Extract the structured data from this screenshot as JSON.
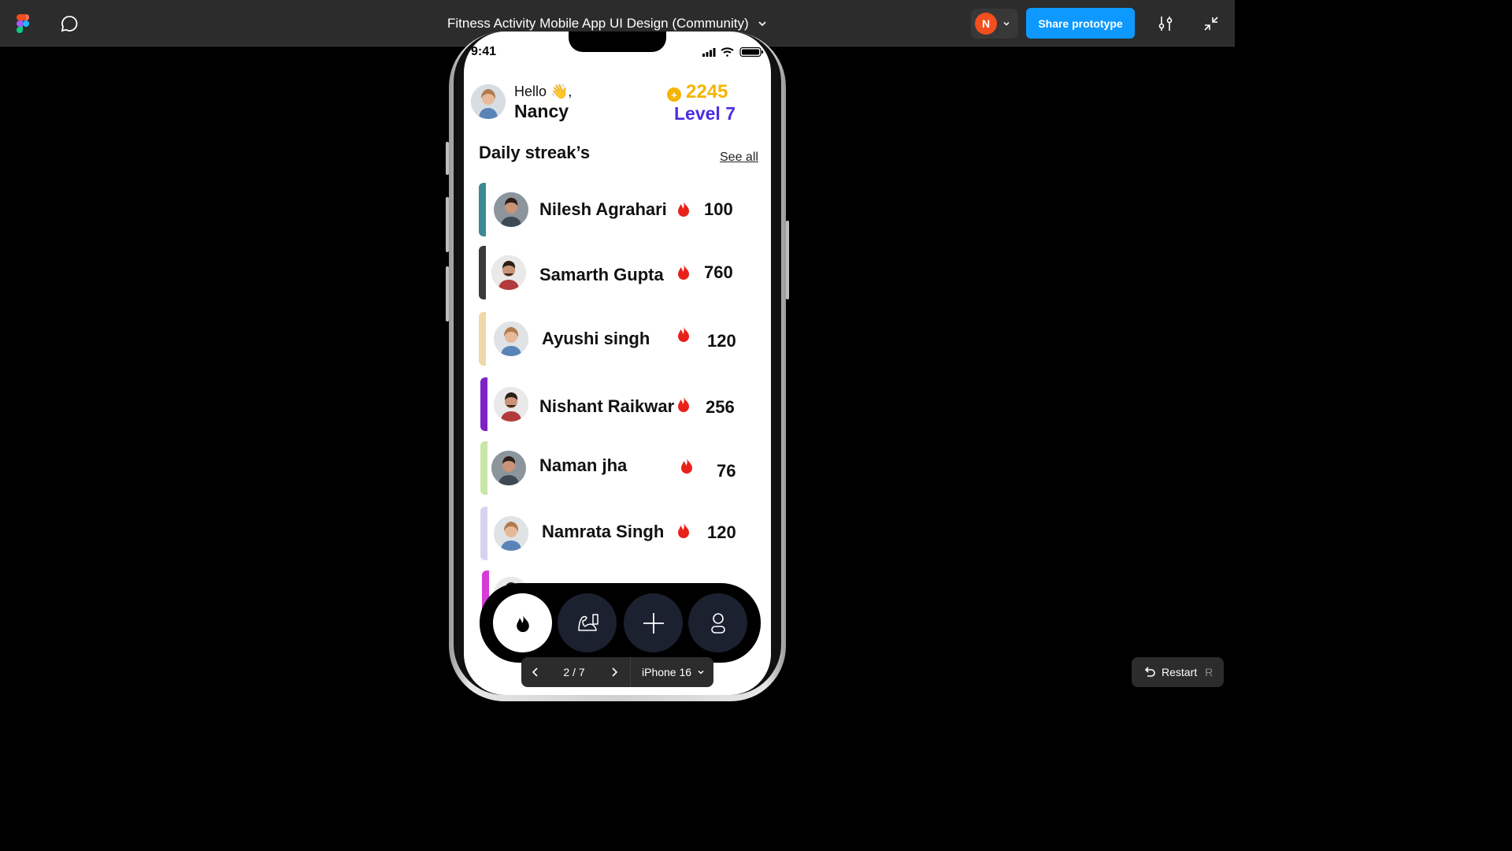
{
  "app": {
    "file_title": "Fitness Activity Mobile App UI Design (Community)",
    "user_initial": "N",
    "share_label": "Share prototype",
    "brand_color": "#0d99ff"
  },
  "phone": {
    "status_time": "9:41",
    "greeting": "Hello 👋,",
    "user_name": "Nancy",
    "coins": "2245",
    "level": "Level 7",
    "coin_symbol": "+",
    "section_title": "Daily streak’s",
    "see_all": "See all",
    "streaks": [
      {
        "name": "Nilesh Agrahari",
        "score": "100",
        "color": "#3c8a93"
      },
      {
        "name": "Samarth Gupta",
        "score": "760",
        "color": "#3a3a3a"
      },
      {
        "name": "Ayushi singh",
        "score": "120",
        "color": "#efd9a8"
      },
      {
        "name": "Nishant Raikwar",
        "score": "256",
        "color": "#7d22c7"
      },
      {
        "name": "Naman jha",
        "score": "76",
        "color": "#c8e6a6"
      },
      {
        "name": "Namrata Singh",
        "score": "120",
        "color": "#d6d3f0"
      }
    ],
    "nav_icons": [
      "flame-icon",
      "muscle-icon",
      "plus-icon",
      "profile-icon"
    ]
  },
  "controls": {
    "page_indicator": "2 / 7",
    "device": "iPhone 16",
    "restart_label": "Restart",
    "restart_key": "R"
  }
}
